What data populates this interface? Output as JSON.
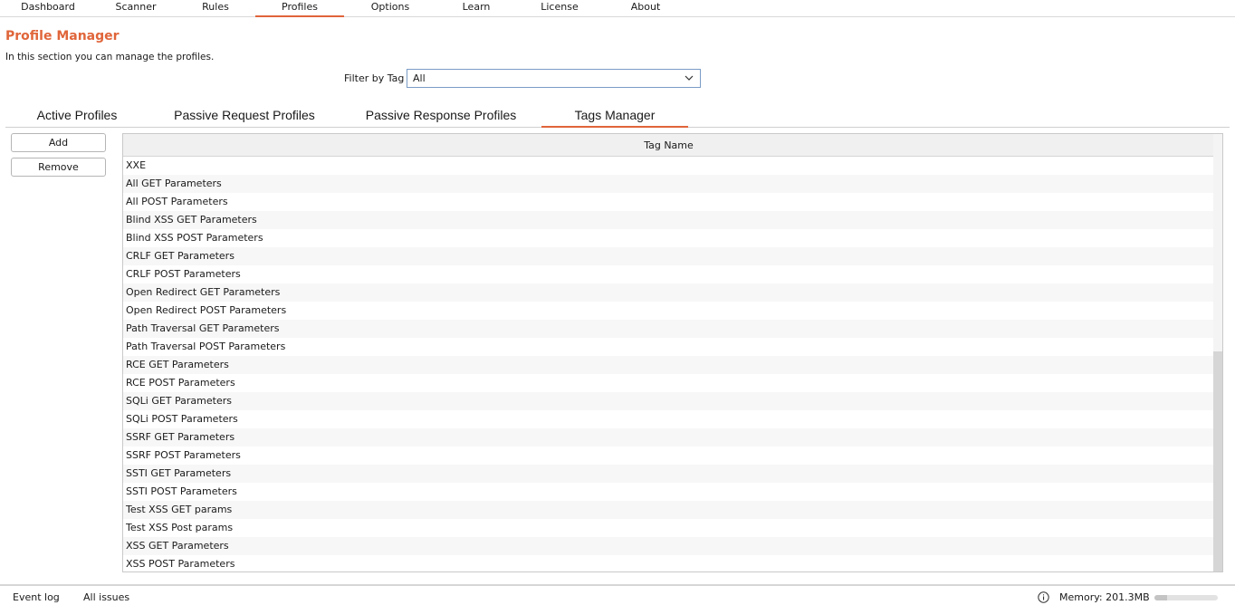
{
  "topnav": {
    "tabs": [
      {
        "label": "Dashboard"
      },
      {
        "label": "Scanner"
      },
      {
        "label": "Rules"
      },
      {
        "label": "Profiles",
        "active": true
      },
      {
        "label": "Options"
      },
      {
        "label": "Learn"
      },
      {
        "label": "License"
      },
      {
        "label": "About"
      }
    ]
  },
  "page": {
    "title": "Profile Manager",
    "description": "In this section you can manage the profiles."
  },
  "filter": {
    "label": "Filter by Tag",
    "selected": "All",
    "icon": "chevron-down-icon"
  },
  "subtabs": [
    {
      "label": "Active Profiles"
    },
    {
      "label": "Passive Request Profiles"
    },
    {
      "label": "Passive Response Profiles"
    },
    {
      "label": "Tags Manager",
      "active": true
    }
  ],
  "actions": {
    "add_label": "Add",
    "remove_label": "Remove"
  },
  "table": {
    "header": "Tag Name",
    "rows": [
      "XXE",
      "All GET Parameters",
      "All POST Parameters",
      "Blind XSS GET Parameters",
      "Blind XSS POST Parameters",
      "CRLF GET Parameters",
      "CRLF POST Parameters",
      "Open Redirect GET Parameters",
      "Open Redirect POST Parameters",
      "Path Traversal GET Parameters",
      "Path Traversal POST Parameters",
      "RCE GET Parameters",
      "RCE POST Parameters",
      "SQLi GET Parameters",
      "SQLi POST Parameters",
      "SSRF GET Parameters",
      "SSRF POST Parameters",
      "SSTI GET Parameters",
      "SSTI POST Parameters",
      "Test XSS GET params",
      "Test XSS Post params",
      "XSS GET Parameters",
      "XSS POST Parameters"
    ]
  },
  "statusbar": {
    "event_log": "Event log",
    "all_issues": "All issues",
    "memory": "Memory: 201.3MB",
    "memory_fraction": 0.2,
    "info_icon": "info-icon"
  },
  "colors": {
    "accent": "#e0653a"
  }
}
